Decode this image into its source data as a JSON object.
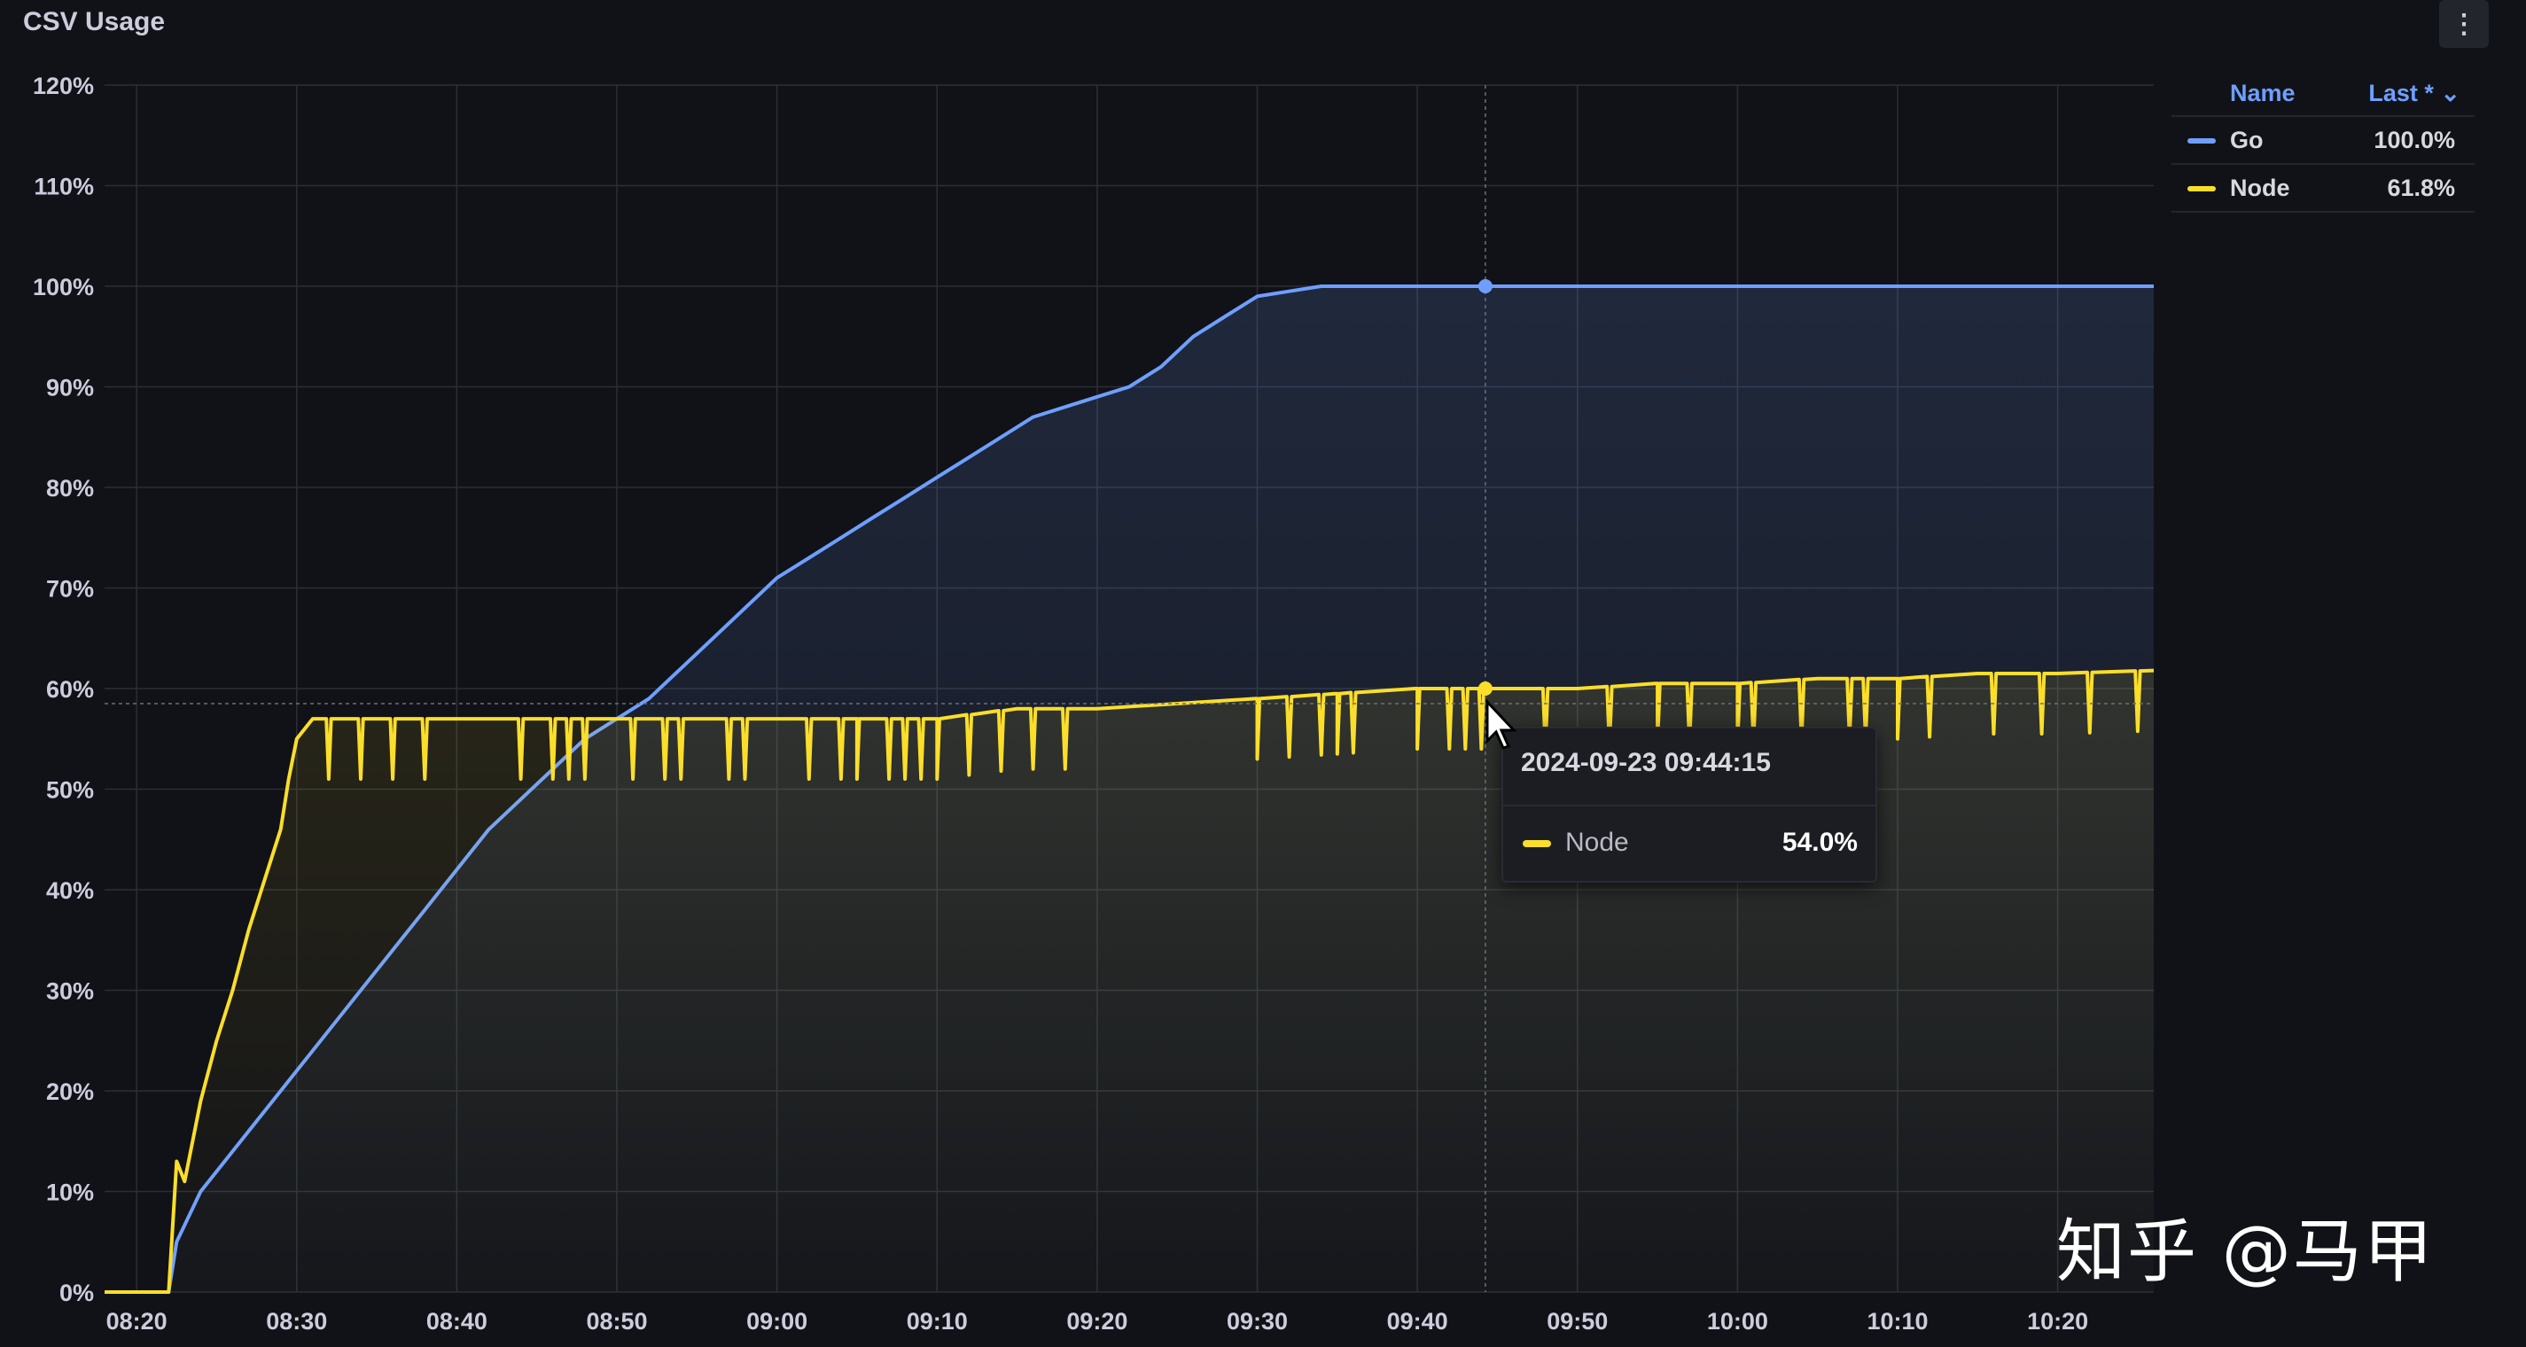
{
  "panel": {
    "title": "CSV Usage"
  },
  "legend": {
    "name_header": "Name",
    "last_header": "Last *",
    "items": [
      {
        "name": "Go",
        "last": "100.0%",
        "color": "#6e9fff"
      },
      {
        "name": "Node",
        "last": "61.8%",
        "color": "#fade2a"
      }
    ]
  },
  "tooltip": {
    "time": "2024-09-23 09:44:15",
    "series": "Node",
    "value": "54.0%",
    "color": "#fade2a"
  },
  "watermark": "知乎 @马甲",
  "chart_data": {
    "type": "line",
    "xlabel": "",
    "ylabel": "",
    "x_ticks": [
      "08:20",
      "08:30",
      "08:40",
      "08:50",
      "09:00",
      "09:10",
      "09:20",
      "09:30",
      "09:40",
      "09:50",
      "10:00",
      "10:10",
      "10:20"
    ],
    "y_ticks": [
      "0%",
      "10%",
      "20%",
      "30%",
      "40%",
      "50%",
      "60%",
      "70%",
      "80%",
      "90%",
      "100%",
      "110%",
      "120%"
    ],
    "xlim": [
      "08:18",
      "10:26"
    ],
    "ylim": [
      0,
      120
    ],
    "grid": true,
    "legend_position": "right",
    "series": [
      {
        "name": "Go",
        "color": "#6e9fff",
        "fill": true,
        "points": [
          [
            "08:18",
            0
          ],
          [
            "08:22",
            0
          ],
          [
            "08:22.5",
            5
          ],
          [
            "08:24",
            10
          ],
          [
            "08:26",
            14
          ],
          [
            "08:28",
            18
          ],
          [
            "08:30",
            22
          ],
          [
            "08:32",
            26
          ],
          [
            "08:34",
            30
          ],
          [
            "08:36",
            34
          ],
          [
            "08:38",
            38
          ],
          [
            "08:40",
            42
          ],
          [
            "08:42",
            46
          ],
          [
            "08:44",
            49
          ],
          [
            "08:46",
            52
          ],
          [
            "08:48",
            55
          ],
          [
            "08:50",
            57
          ],
          [
            "08:52",
            59
          ],
          [
            "08:54",
            62
          ],
          [
            "08:56",
            65
          ],
          [
            "08:58",
            68
          ],
          [
            "09:00",
            71
          ],
          [
            "09:02",
            73
          ],
          [
            "09:04",
            75
          ],
          [
            "09:06",
            77
          ],
          [
            "09:08",
            79
          ],
          [
            "09:10",
            81
          ],
          [
            "09:12",
            83
          ],
          [
            "09:14",
            85
          ],
          [
            "09:16",
            87
          ],
          [
            "09:18",
            88
          ],
          [
            "09:20",
            89
          ],
          [
            "09:22",
            90
          ],
          [
            "09:24",
            92
          ],
          [
            "09:26",
            95
          ],
          [
            "09:28",
            97
          ],
          [
            "09:30",
            99
          ],
          [
            "09:32",
            99.5
          ],
          [
            "09:34",
            100
          ],
          [
            "09:40",
            100
          ],
          [
            "09:50",
            100
          ],
          [
            "10:00",
            100
          ],
          [
            "10:10",
            100
          ],
          [
            "10:20",
            100
          ],
          [
            "10:26",
            100
          ]
        ]
      },
      {
        "name": "Node",
        "color": "#fade2a",
        "fill": true,
        "points": [
          [
            "08:18",
            0
          ],
          [
            "08:22",
            0
          ],
          [
            "08:22.5",
            13
          ],
          [
            "08:23",
            11
          ],
          [
            "08:24",
            19
          ],
          [
            "08:25",
            25
          ],
          [
            "08:26",
            30
          ],
          [
            "08:27",
            36
          ],
          [
            "08:28",
            41
          ],
          [
            "08:29",
            46
          ],
          [
            "08:29.5",
            51
          ],
          [
            "08:30",
            55
          ],
          [
            "08:31",
            57
          ],
          [
            "08:35",
            57
          ],
          [
            "08:40",
            57
          ],
          [
            "08:45",
            57
          ],
          [
            "08:50",
            57
          ],
          [
            "08:55",
            57
          ],
          [
            "09:00",
            57
          ],
          [
            "09:05",
            57
          ],
          [
            "09:10",
            57
          ],
          [
            "09:15",
            58
          ],
          [
            "09:20",
            58
          ],
          [
            "09:25",
            58.5
          ],
          [
            "09:30",
            59
          ],
          [
            "09:35",
            59.5
          ],
          [
            "09:40",
            60
          ],
          [
            "09:45",
            60
          ],
          [
            "09:50",
            60
          ],
          [
            "09:55",
            60.5
          ],
          [
            "10:00",
            60.5
          ],
          [
            "10:05",
            61
          ],
          [
            "10:10",
            61
          ],
          [
            "10:15",
            61.5
          ],
          [
            "10:20",
            61.5
          ],
          [
            "10:26",
            61.8
          ]
        ],
        "dips": [
          "08:32",
          "08:34",
          "08:36",
          "08:38",
          "08:44",
          "08:46",
          "08:47",
          "08:48",
          "08:51",
          "08:53",
          "08:54",
          "08:57",
          "08:58",
          "09:02",
          "09:04",
          "09:05",
          "09:07",
          "09:08",
          "09:09",
          "09:10",
          "09:12",
          "09:14",
          "09:16",
          "09:18",
          "09:30",
          "09:32",
          "09:34",
          "09:35",
          "09:36",
          "09:40",
          "09:42",
          "09:43",
          "09:44",
          "09:48",
          "09:52",
          "09:55",
          "09:57",
          "10:00",
          "10:01",
          "10:04",
          "10:07",
          "10:08",
          "10:10",
          "10:12",
          "10:16",
          "10:19",
          "10:22",
          "10:25"
        ]
      }
    ],
    "hover": {
      "x": "09:44:15",
      "series": "Node",
      "value": 54.0
    }
  }
}
